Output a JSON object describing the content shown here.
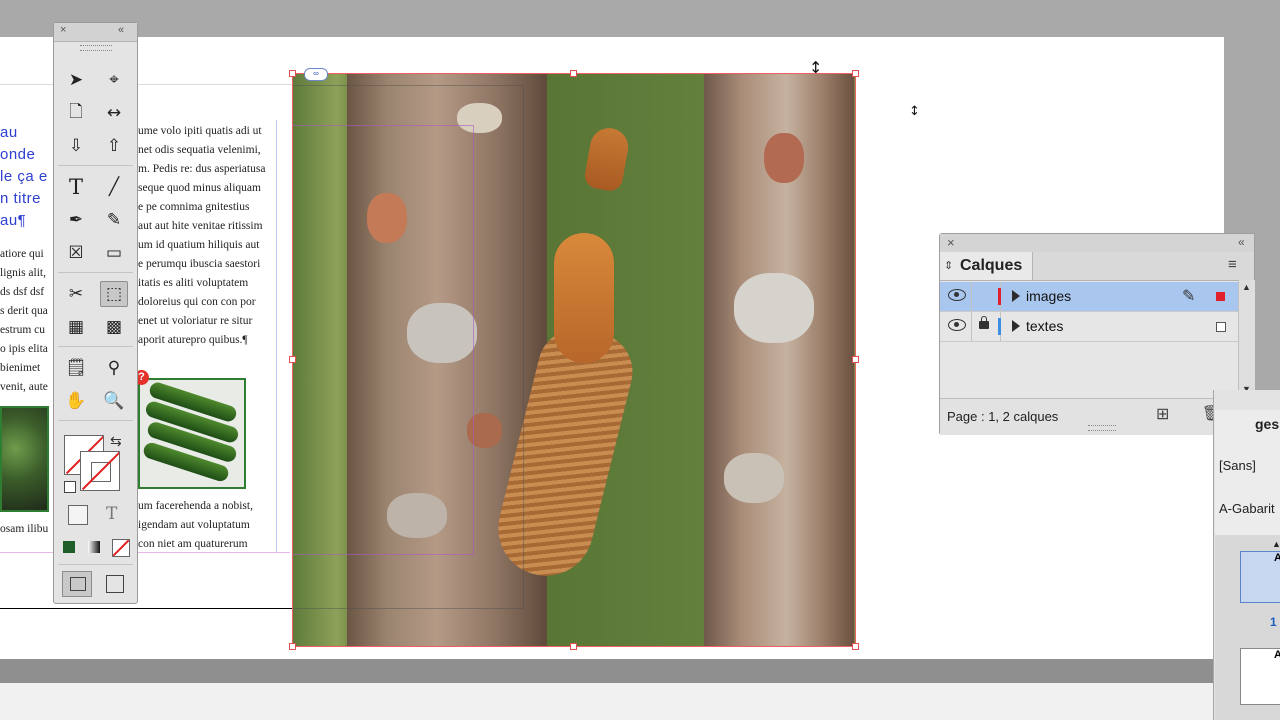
{
  "document": {
    "left_headline_lines": [
      "au",
      "onde",
      "le ça e",
      "n titre",
      "au¶"
    ],
    "left_body_lines": [
      "atiore qui",
      "lignis alit,",
      "ds dsf dsf",
      "s derit qua",
      "estrum cu",
      "o ipis elita",
      "bienimet",
      "venit, aute"
    ],
    "right_body_lines": [
      "ume volo ipiti quatis adi ut",
      "net odis sequatia velenimi,",
      "m. Pedis re: dus asperiatusa",
      "seque quod minus aliquam",
      "e pe comnima gnitestius",
      "aut aut hite venitae ritissim",
      "um id quatium hiliquis aut",
      "e perumqu ibuscia saestori",
      "itatis es aliti voluptatem",
      "doloreius qui con con por",
      "enet ut voloriatur re situr",
      "aporit aturepro quibus.¶"
    ],
    "right_body_lines_lower": [
      "um facerehenda a nobist,",
      "igendam aut voluptatum",
      "con niet am quaturerum"
    ],
    "left_body_lower": [
      "osam ilibu"
    ],
    "error_badge": "?",
    "link_badge": "∞"
  },
  "toolbox": {
    "close_glyph": "×",
    "collapse_glyph": "«",
    "tools": [
      {
        "name": "selection-tool",
        "glyph": "➤"
      },
      {
        "name": "direct-selection-tool",
        "glyph": "⌖"
      },
      {
        "name": "page-tool",
        "glyph": "🗋"
      },
      {
        "name": "gap-tool",
        "glyph": "↔"
      },
      {
        "name": "content-collector-tool",
        "glyph": "⇩"
      },
      {
        "name": "content-placer-tool",
        "glyph": "⇧"
      },
      {
        "name": "type-tool",
        "glyph": "T"
      },
      {
        "name": "line-tool",
        "glyph": "╱"
      },
      {
        "name": "pen-tool",
        "glyph": "✒"
      },
      {
        "name": "pencil-tool",
        "glyph": "✎"
      },
      {
        "name": "rectangle-frame-tool",
        "glyph": "☒"
      },
      {
        "name": "rectangle-tool",
        "glyph": "▭"
      },
      {
        "name": "scissors-tool",
        "glyph": "✂"
      },
      {
        "name": "free-transform-tool",
        "glyph": "⬚"
      },
      {
        "name": "gradient-swatch-tool",
        "glyph": "▦"
      },
      {
        "name": "gradient-feather-tool",
        "glyph": "▩"
      },
      {
        "name": "note-tool",
        "glyph": "🗒"
      },
      {
        "name": "eyedropper-tool",
        "glyph": "⚲"
      },
      {
        "name": "hand-tool",
        "glyph": "✋"
      },
      {
        "name": "zoom-tool",
        "glyph": "🔍"
      }
    ],
    "format_text_glyph": "T"
  },
  "layers_panel": {
    "title": "Calques",
    "close_glyph": "×",
    "collapse_glyph": "«",
    "menu_glyph": "≡",
    "layers": [
      {
        "name": "images",
        "color": "#e0202a",
        "selected": true,
        "locked": false
      },
      {
        "name": "textes",
        "color": "#3d8de0",
        "selected": false,
        "locked": true
      }
    ],
    "footer_text": "Page : 1, 2 calques",
    "new_layer_glyph": "⊞",
    "delete_glyph": "🗑"
  },
  "right_panel": {
    "heading_partial": "ges",
    "style_label_1": "[Sans]",
    "style_label_2": "A-Gabarit",
    "page_number": "1",
    "thumb_letter": "A"
  },
  "colors": {
    "layer_images": "#e0202a",
    "layer_textes": "#3d8de0",
    "selection_frame": "#f06060",
    "headline_blue": "#2d3fd0",
    "panel_selected": "#a9c7ee"
  }
}
